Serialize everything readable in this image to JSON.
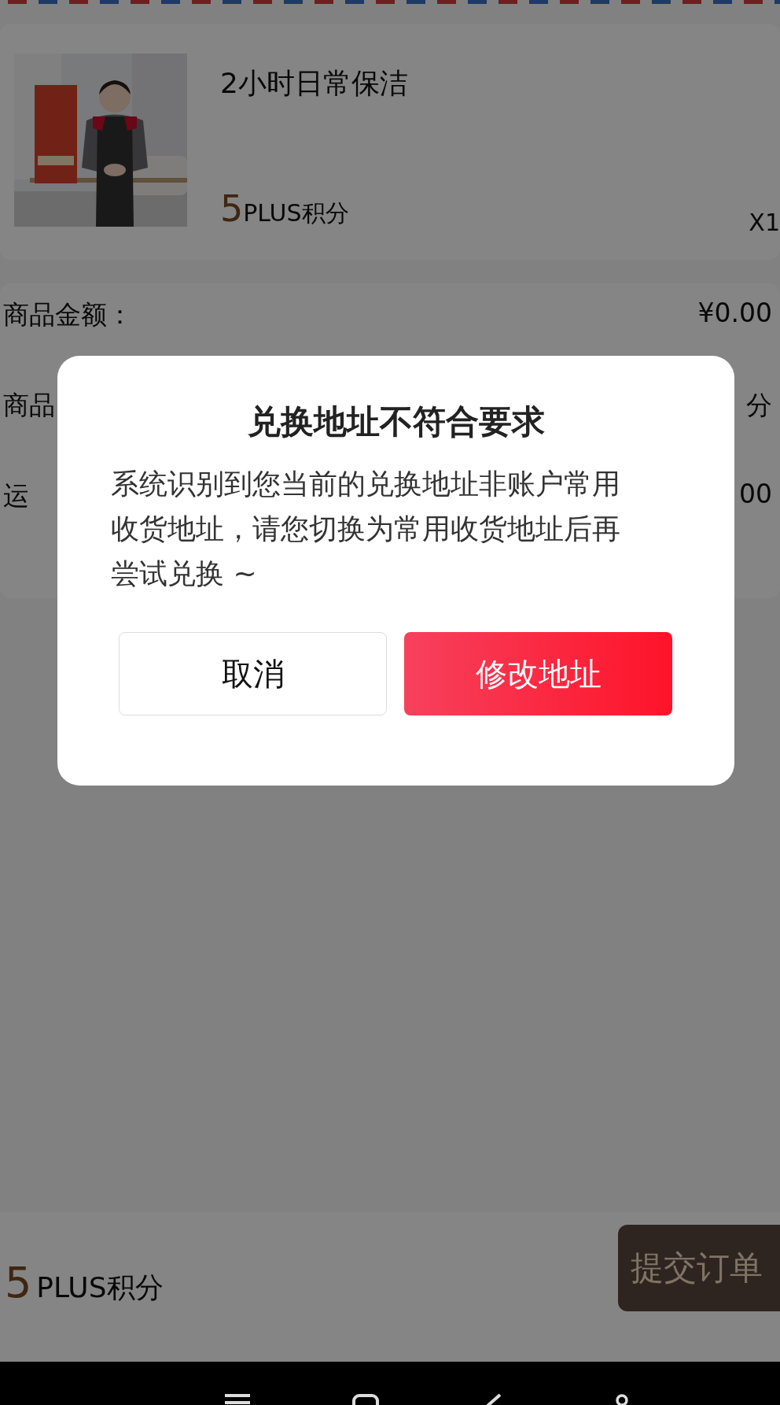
{
  "product": {
    "title": "2小时日常保洁",
    "price": "5",
    "price_unit": "PLUS积分",
    "quantity": "X1"
  },
  "summary": [
    {
      "label": "商品金额：",
      "value": "¥0.00"
    },
    {
      "label": "商品",
      "value": "分"
    },
    {
      "label": "运",
      "value": "00"
    }
  ],
  "dialog": {
    "title": "兑换地址不符合要求",
    "message": "系统识别到您当前的兑换地址非账户常用收货地址，请您切换为常用收货地址后再尝试兑换 ~",
    "buttons": [
      {
        "label": "取消",
        "kind": "secondary"
      },
      {
        "label": "修改地址",
        "kind": "primary"
      }
    ]
  },
  "footer": {
    "total": "5",
    "total_unit": "PLUS积分",
    "submit": "提交订单"
  }
}
